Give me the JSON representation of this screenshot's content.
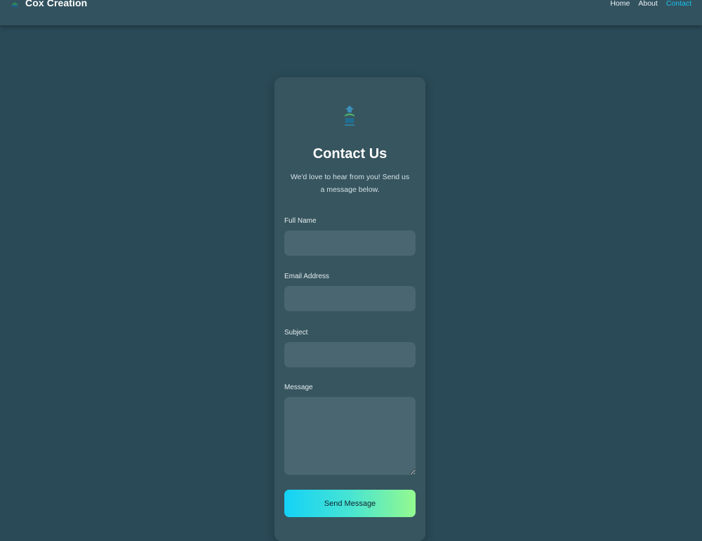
{
  "brand": {
    "name": "Cox Creation",
    "logo_icon": "cox-creation-logo-icon"
  },
  "nav": {
    "items": [
      {
        "label": "Home",
        "active": false
      },
      {
        "label": "About",
        "active": false
      },
      {
        "label": "Contact",
        "active": true
      }
    ]
  },
  "contact": {
    "title": "Contact Us",
    "subtitle": "We'd love to hear from you! Send us a message below.",
    "fields": {
      "full_name": {
        "label": "Full Name",
        "value": "",
        "placeholder": ""
      },
      "email": {
        "label": "Email Address",
        "value": "",
        "placeholder": ""
      },
      "subject": {
        "label": "Subject",
        "value": "",
        "placeholder": ""
      },
      "message": {
        "label": "Message",
        "value": "",
        "placeholder": ""
      }
    },
    "submit_label": "Send Message"
  },
  "colors": {
    "background": "#2a4a57",
    "card": "#37555f",
    "input": "#4a6670",
    "accent_active": "#19c3f0",
    "button_gradient_start": "#14d2f7",
    "button_gradient_end": "#94f98f"
  }
}
